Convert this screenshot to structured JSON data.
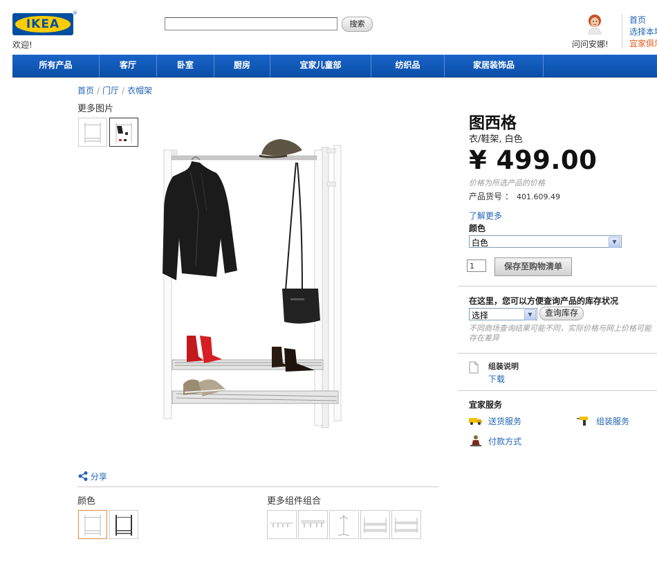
{
  "header": {
    "logo_text": "IKEA",
    "logo_mark": "®",
    "welcome": "欢迎!",
    "search_placeholder": "",
    "search_button": "搜索",
    "ask_anna": "问问安娜!",
    "top_links": [
      "首页",
      "选择本地",
      "宜家俱乐"
    ]
  },
  "nav": [
    "所有产品",
    "客厅",
    "卧室",
    "厨房",
    "宜家儿童部",
    "纺织品",
    "家居装饰品"
  ],
  "breadcrumb": [
    "首页",
    "门厅",
    "衣帽架"
  ],
  "gallery": {
    "more_pictures": "更多图片"
  },
  "product": {
    "name": "图西格",
    "description": "衣/鞋架, 白色",
    "price": "¥ 499.00",
    "price_note": "价格为所选产品的价格",
    "article_label": "产品货号 ：",
    "article_number": "401.609.49",
    "learn_more": "了解更多",
    "color_label": "颜色",
    "color_selected": "白色",
    "quantity": "1",
    "save_button": "保存至购物清单"
  },
  "stock": {
    "title": "在这里，您可以方便查询产品的库存状况",
    "store_selected": "选择",
    "check_button": "查询库存",
    "note": "不同商场查询结果可能不同，实际价格与网上价格可能存在差异"
  },
  "assembly": {
    "title": "组装说明",
    "download": "下载"
  },
  "services": {
    "title": "宜家服务",
    "delivery": "送货服务",
    "assembly": "组装服务",
    "payment": "付款方式"
  },
  "bottom": {
    "share": "分享",
    "color_label": "颜色",
    "more_combinations": "更多组件组合"
  },
  "colors": {
    "nav_blue": "#0a55b4",
    "link_blue": "#1f64b4",
    "logo_yellow": "#ffcc00",
    "top_link_orange": "#e8591a"
  }
}
